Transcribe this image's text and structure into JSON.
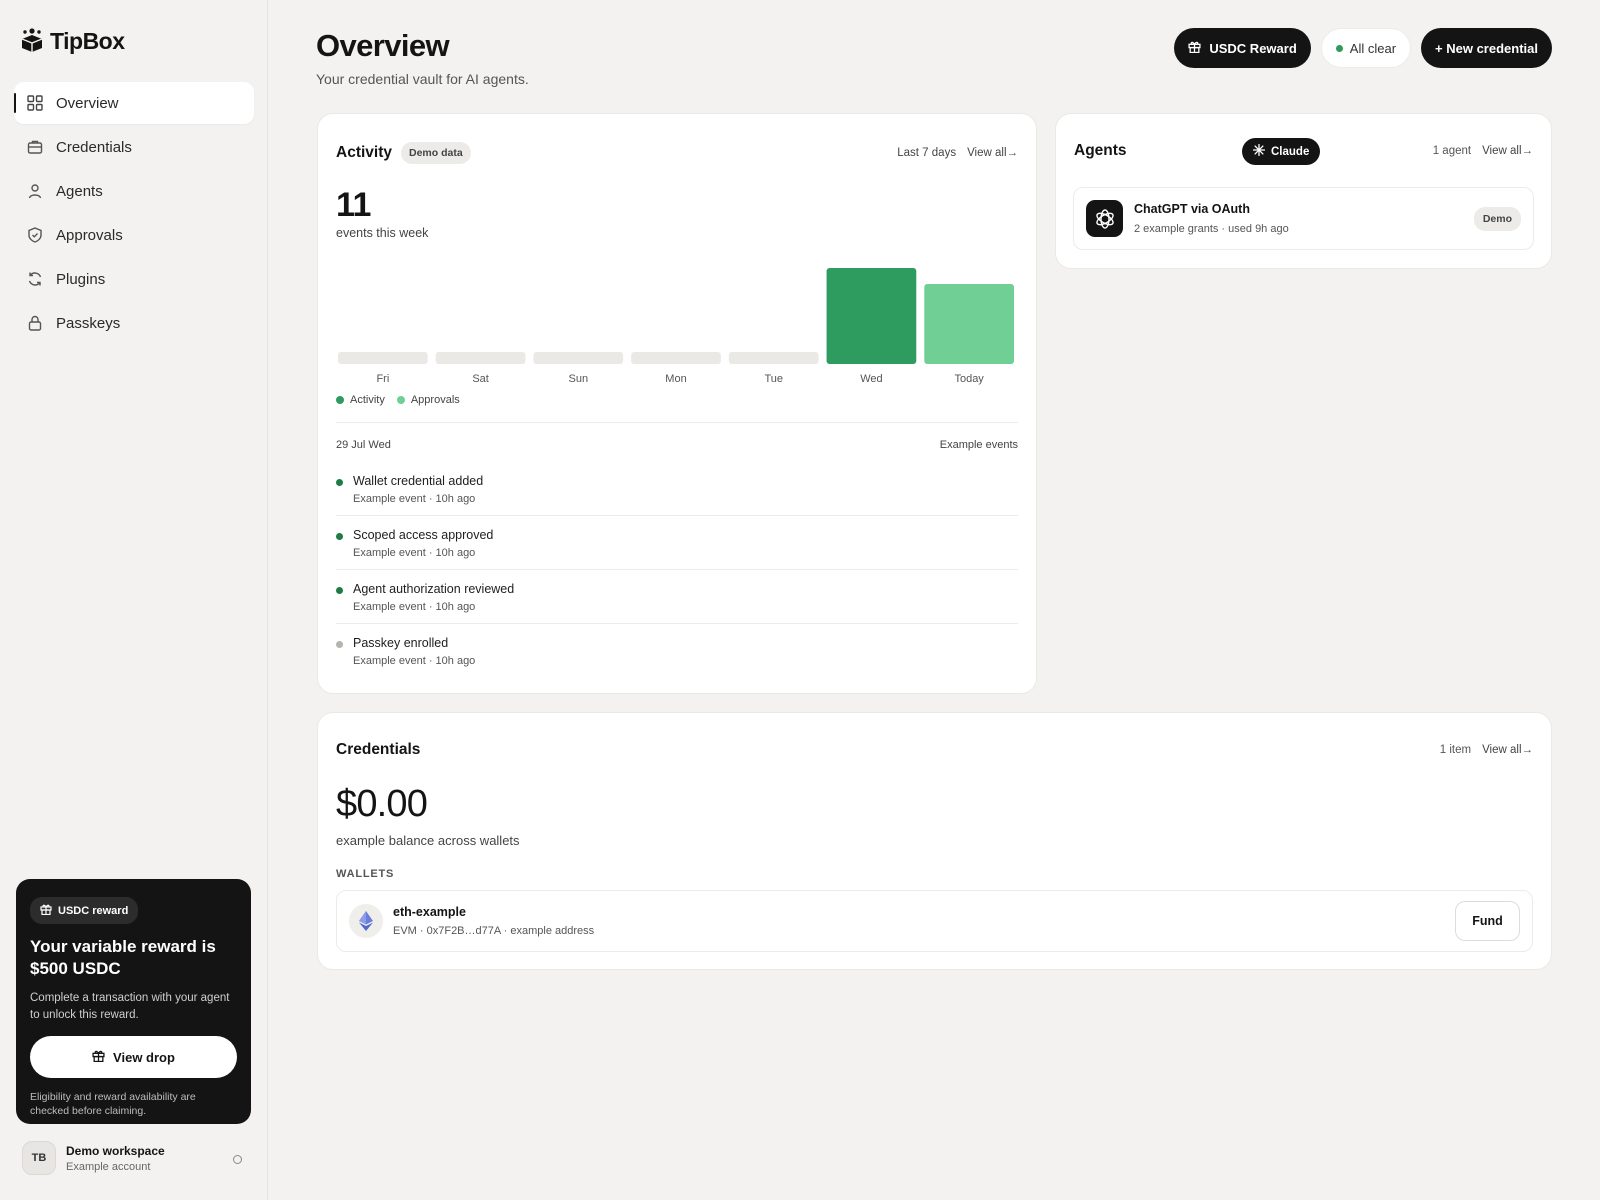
{
  "app": {
    "name": "TipBox"
  },
  "sidebar": {
    "items": [
      {
        "label": "Overview",
        "icon": "grid-icon",
        "active": true
      },
      {
        "label": "Credentials",
        "icon": "briefcase-icon",
        "active": false
      },
      {
        "label": "Agents",
        "icon": "user-icon",
        "active": false
      },
      {
        "label": "Approvals",
        "icon": "shield-check-icon",
        "active": false
      },
      {
        "label": "Plugins",
        "icon": "refresh-icon",
        "active": false
      },
      {
        "label": "Passkeys",
        "icon": "lock-icon",
        "active": false
      }
    ],
    "reward": {
      "pill": "USDC reward",
      "title": "Your variable reward is $500 USDC",
      "description": "Complete a transaction with your agent to unlock this reward.",
      "button": "View drop",
      "note": "Eligibility and reward availability are checked before claiming."
    },
    "account": {
      "initials": "TB",
      "name": "Demo workspace",
      "subtitle": "Example account"
    }
  },
  "header": {
    "title": "Overview",
    "subtitle": "Your credential vault for AI agents.",
    "reward_button": "USDC Reward",
    "status": "All clear",
    "new_button": "+ New credential"
  },
  "activity": {
    "title": "Activity",
    "tag": "Demo data",
    "range": "Last 7 days",
    "view_all": "View all→",
    "count": "11",
    "count_label": "events this week",
    "legend": [
      "Activity",
      "Approvals"
    ],
    "date_label": "29 Jul Wed",
    "examples_label": "Example events",
    "events": [
      {
        "title": "Wallet credential added",
        "meta": "Example event · 10h ago",
        "status": "green"
      },
      {
        "title": "Scoped access approved",
        "meta": "Example event · 10h ago",
        "status": "green"
      },
      {
        "title": "Agent authorization reviewed",
        "meta": "Example event · 10h ago",
        "status": "green"
      },
      {
        "title": "Passkey enrolled",
        "meta": "Example event · 10h ago",
        "status": "gray"
      }
    ]
  },
  "chart_data": {
    "type": "bar",
    "categories": [
      "Fri",
      "Sat",
      "Sun",
      "Mon",
      "Tue",
      "Wed",
      "Today"
    ],
    "series": [
      {
        "name": "Activity",
        "values": [
          0,
          0,
          0,
          0,
          0,
          6,
          0
        ]
      },
      {
        "name": "Approvals",
        "values": [
          0,
          0,
          0,
          0,
          0,
          0,
          5
        ]
      }
    ],
    "ylim": [
      0,
      6
    ],
    "colors": {
      "Activity": "#2e9b5f",
      "Approvals": "#6fcf95",
      "empty": "#ebe9e5"
    }
  },
  "agents": {
    "title": "Agents",
    "claude_pill": "Claude",
    "count": "1 agent",
    "view_all": "View all→",
    "items": [
      {
        "name": "ChatGPT via OAuth",
        "meta": "2 example grants · used 9h ago",
        "badge": "Demo"
      }
    ]
  },
  "credentials": {
    "title": "Credentials",
    "count": "1 item",
    "view_all": "View all→",
    "balance": "$0.00",
    "balance_label": "example balance across wallets",
    "wallets_label": "WALLETS",
    "wallets": [
      {
        "name": "eth-example",
        "meta": "EVM · 0x7F2B…d77A · example address",
        "button": "Fund"
      }
    ]
  },
  "colors": {
    "accent": "#2e9b57",
    "dark": "#141414",
    "background": "#f3f2f0"
  }
}
